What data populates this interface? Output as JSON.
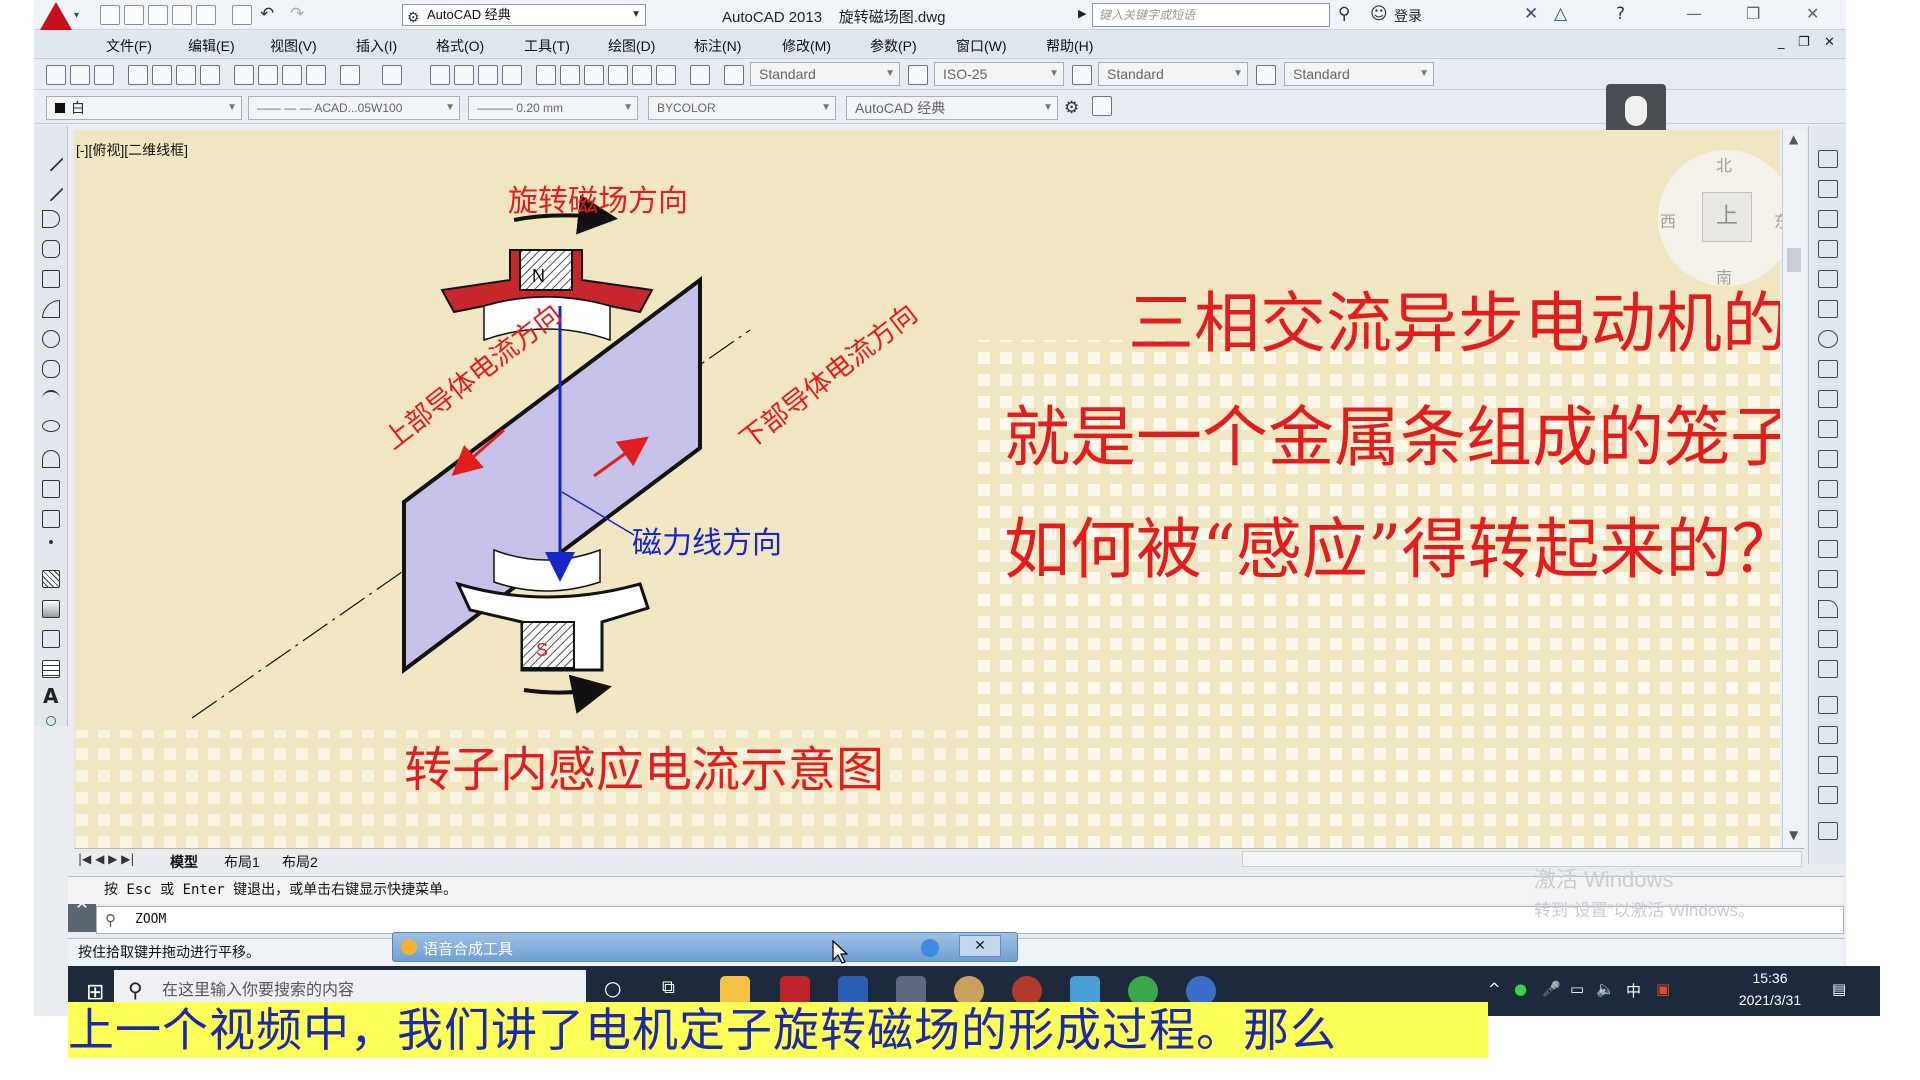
{
  "titlebar": {
    "workspace": "AutoCAD 经典",
    "app_title": "AutoCAD 2013",
    "file_name": "旋转磁场图.dwg",
    "search_placeholder": "键入关键字或短语",
    "login_label": "登录"
  },
  "menu": [
    "文件(F)",
    "编辑(E)",
    "视图(V)",
    "插入(I)",
    "格式(O)",
    "工具(T)",
    "绘图(D)",
    "标注(N)",
    "修改(M)",
    "参数(P)",
    "窗口(W)",
    "帮助(H)"
  ],
  "toolbar1": {
    "text_style": "Standard",
    "dim_style": "ISO-25",
    "table_style": "Standard",
    "mleader_style": "Standard"
  },
  "toolbar2": {
    "layer": "白",
    "linetype": "ACAD...05W100",
    "lineweight": "0.20 mm",
    "plotstyle": "BYCOLOR",
    "workspace": "AutoCAD 经典"
  },
  "viewport_label": "[-][俯视][二维线框]",
  "compass": {
    "north": "北",
    "south": "南",
    "west": "西",
    "east": "东",
    "face": "上"
  },
  "drawing": {
    "title_top": "旋转磁场方向",
    "north_pole": "N",
    "south_pole": "S",
    "upper_current": "上部导体电流方向",
    "lower_current": "下部导体电流方向",
    "flux_direction": "磁力线方向",
    "diagram_caption": "转子内感应电流示意图"
  },
  "question_lines": [
    "三相交流异步电动机的转子",
    "就是一个金属条组成的笼子，是",
    "如何被“感应”得转起来的？"
  ],
  "layout_tabs": [
    "模型",
    "布局1",
    "布局2"
  ],
  "command": {
    "history": "按 Esc 或 Enter 键退出，或单击右键显示快捷菜单。",
    "current": "ZOOM"
  },
  "status_text": "按住拾取键并拖动进行平移。",
  "popup_title": "语音合成工具",
  "watermark": {
    "line1": "激活 Windows",
    "line2": "转到“设置”以激活 Windows。"
  },
  "taskbar": {
    "search_placeholder": "在这里输入你要搜索的内容",
    "ime": "中",
    "time": "15:36",
    "date": "2021/3/31"
  },
  "subtitle": "上一个视频中，我们讲了电机定子旋转磁场的形成过程。那么",
  "colors": {
    "canvas": "#f1e6c2",
    "red_text": "#e21d1d",
    "blue_text": "#1726c4",
    "subtitle_bg": "#ffff59",
    "plate": "#c7c2ea"
  }
}
